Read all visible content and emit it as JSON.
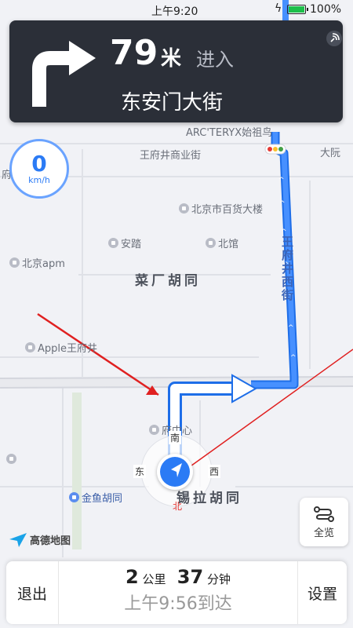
{
  "status": {
    "time": "上午9:20",
    "battery": "100%"
  },
  "guidance": {
    "distance": "79",
    "unit": "米",
    "action": "进入",
    "road": "东安门大街",
    "turn_icon": "turn-right-icon"
  },
  "speed": {
    "value": "0",
    "unit": "km/h"
  },
  "map": {
    "pois": {
      "arcteryx": "ARC'TERYX始祖鸟",
      "wangfujing_shangye": "王府井商业街",
      "dayuan": "大阮",
      "baihuo": "北京市百货大楼",
      "anta": "安踏",
      "beiguan": "北馆",
      "apm": "北京apm",
      "apple": "Apple王府井",
      "fuzhongxin": "府中心",
      "jinyu": "金鱼胡同",
      "fu_left": "府"
    },
    "streets": {
      "caichang": "菜厂胡同",
      "xila": "锡拉胡同",
      "wangfujing_xijie": "王府井西街"
    },
    "compass": {
      "north": "北",
      "south": "南",
      "east": "东",
      "west": "西"
    }
  },
  "overview": {
    "label": "全览"
  },
  "logo": {
    "text": "高德地图"
  },
  "bottom": {
    "exit": "退出",
    "distance_num": "2",
    "distance_unit": "公里",
    "duration_num": "37",
    "duration_unit": "分钟",
    "arrival": "上午9:56到达",
    "settings": "设置"
  },
  "colors": {
    "route": "#2b7bf5",
    "card": "#2b2f38",
    "annotation": "#e02020"
  }
}
